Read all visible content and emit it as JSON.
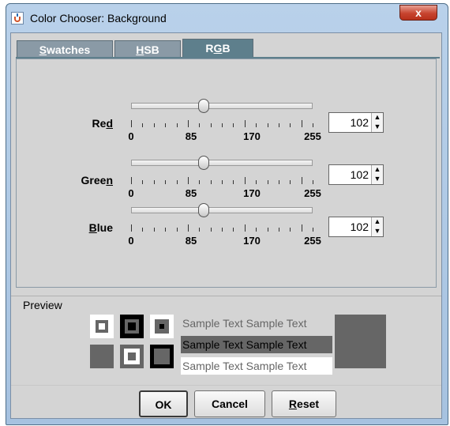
{
  "window": {
    "title": "Color Chooser: Background",
    "close_label": "x"
  },
  "tabs": [
    {
      "label_pre": "",
      "label_u": "S",
      "label_post": "watches",
      "active": false
    },
    {
      "label_pre": "",
      "label_u": "H",
      "label_post": "SB",
      "active": false
    },
    {
      "label_pre": "R",
      "label_u": "G",
      "label_post": "B",
      "active": true
    }
  ],
  "channels": [
    {
      "name_pre": "Re",
      "name_u": "d",
      "name_post": "",
      "value": "102",
      "fraction": 0.4
    },
    {
      "name_pre": "Gree",
      "name_u": "n",
      "name_post": "",
      "value": "102",
      "fraction": 0.4
    },
    {
      "name_pre": "",
      "name_u": "B",
      "name_post": "lue",
      "value": "102",
      "fraction": 0.4
    }
  ],
  "tick_labels": [
    "0",
    "85",
    "170",
    "255"
  ],
  "preview": {
    "label": "Preview",
    "sample_text": "Sample Text  Sample Text",
    "color": "#666666"
  },
  "buttons": {
    "ok": "OK",
    "cancel": "Cancel",
    "reset_u": "R",
    "reset_rest": "eset"
  }
}
